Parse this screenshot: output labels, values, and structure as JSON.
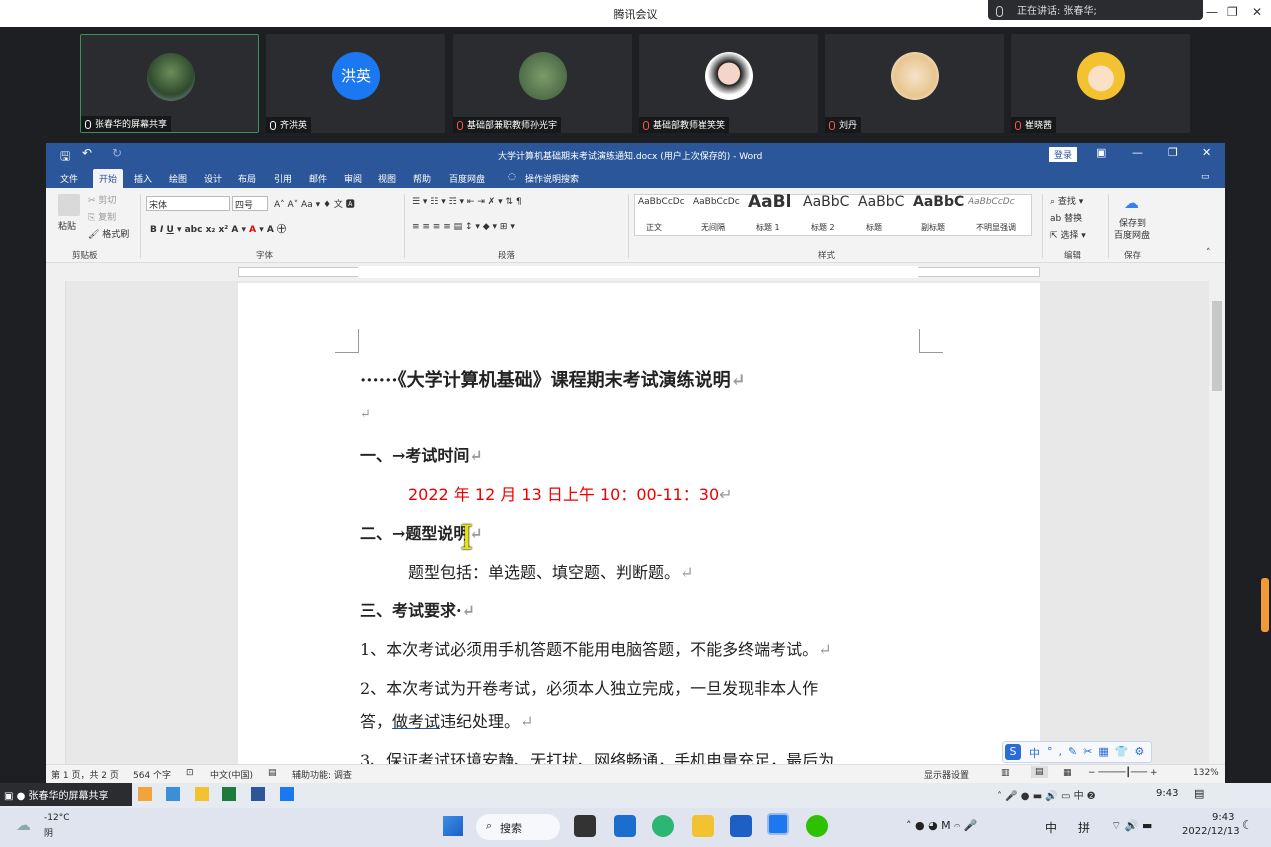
{
  "meeting": {
    "app_title": "腾讯会议",
    "speaking": "正在讲话: 张春华;",
    "participants": [
      {
        "name": "张春华的屏幕共享",
        "avatar_text": ""
      },
      {
        "name": "齐洪英",
        "avatar_text": "洪英"
      },
      {
        "name": "基础部兼职教师孙光宇",
        "avatar_text": ""
      },
      {
        "name": "基础部教师崔笑笑",
        "avatar_text": ""
      },
      {
        "name": "刘丹",
        "avatar_text": ""
      },
      {
        "name": "崔晓茜",
        "avatar_text": ""
      }
    ]
  },
  "word": {
    "title": "大学计算机基础期末考试演练通知.docx (用户上次保存的) - Word",
    "login": "登录",
    "tabs": [
      "文件",
      "开始",
      "插入",
      "绘图",
      "设计",
      "布局",
      "引用",
      "邮件",
      "审阅",
      "视图",
      "帮助",
      "百度网盘"
    ],
    "tell_me": "操作说明搜索",
    "ribbon": {
      "clipboard": {
        "paste": "粘贴",
        "cut": "剪切",
        "copy": "复制",
        "format_painter": "格式刷",
        "label": "剪贴板"
      },
      "font": {
        "name": "宋体",
        "size": "四号",
        "label": "字体"
      },
      "paragraph": {
        "label": "段落"
      },
      "styles": {
        "label": "样式",
        "items": [
          {
            "preview": "AaBbCcDc",
            "name": "正文"
          },
          {
            "preview": "AaBbCcDc",
            "name": "无间隔"
          },
          {
            "preview": "AaBl",
            "name": "标题 1"
          },
          {
            "preview": "AaBbC",
            "name": "标题 2"
          },
          {
            "preview": "AaBbC",
            "name": "标题"
          },
          {
            "preview": "AaBbC",
            "name": "副标题"
          },
          {
            "preview": "AaBbCcDc",
            "name": "不明显强调"
          }
        ]
      },
      "editing": {
        "find": "查找",
        "replace": "替换",
        "select": "选择",
        "label": "编辑"
      },
      "save": {
        "line1": "保存到",
        "line2": "百度网盘",
        "label": "保存"
      }
    },
    "document": {
      "title": "······《大学计算机基础》课程期末考试演练说明",
      "h1": "一、→考试时间",
      "time": "2022 年 12 月 13 日上午 10：00-11：30",
      "h2": "二、→题型说明",
      "types": "题型包括：单选题、填空题、判断题。",
      "h3": "三、考试要求·",
      "r1": "1、本次考试必须用手机答题不能用电脑答题，不能多终端考试。",
      "r2a": "2、本次考试为开卷考试，必须本人独立完成，一旦发现非本人作",
      "r2b_pre": "答，",
      "r2b_link": "做考试",
      "r2b_post": "违纪处理。",
      "r3": "3、保证考试环境安静、无打扰、网络畅通，手机电量充足，最后为"
    },
    "status": {
      "page": "第 1 页，共 2 页",
      "words": "564 个字",
      "lang": "中文(中国)",
      "accessibility": "辅助功能: 调查",
      "display": "显示器设置",
      "zoom": "132%"
    }
  },
  "share_label": "张春华的屏幕共享",
  "ime": "中",
  "tray_share": {
    "time": "9:43"
  },
  "taskbar": {
    "weather_temp": "-12°C",
    "weather_desc": "阴",
    "search": "搜索",
    "tray_ime1": "中",
    "tray_ime2": "拼",
    "time": "9:43",
    "date": "2022/12/13"
  }
}
